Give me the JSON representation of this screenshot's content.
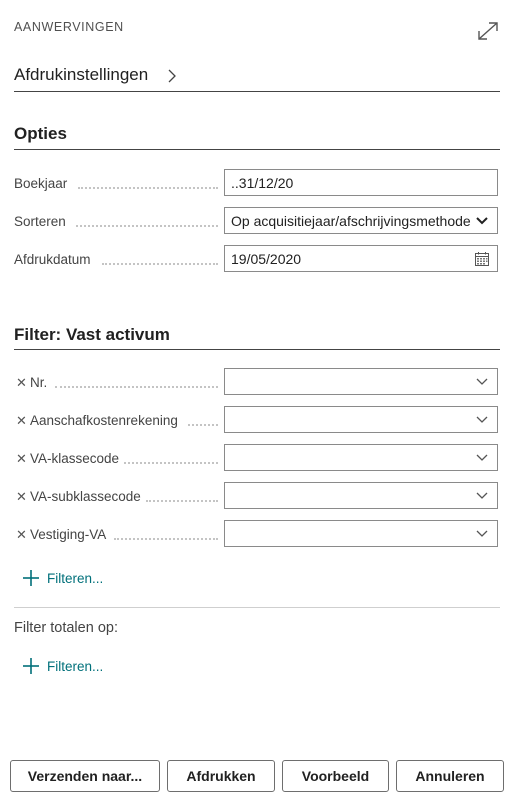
{
  "header": {
    "caption": "AANWERVINGEN",
    "expand_icon": "expand-icon"
  },
  "title": "Afdrukinstellingen",
  "options": {
    "heading": "Opties",
    "fields": [
      {
        "label": "Boekjaar",
        "value": "..31/12/20"
      },
      {
        "label": "Sorteren",
        "value": "Op acquisitiejaar/afschrijvingsmethode"
      },
      {
        "label": "Afdrukdatum",
        "value": "19/05/2020"
      }
    ]
  },
  "filter": {
    "heading": "Filter: Vast activum",
    "fields": [
      {
        "label": "Nr.",
        "value": ""
      },
      {
        "label": "Aanschafkostenrekening",
        "value": ""
      },
      {
        "label": "VA-klassecode",
        "value": ""
      },
      {
        "label": "VA-subklassecode",
        "value": ""
      },
      {
        "label": "Vestiging-VA",
        "value": ""
      }
    ],
    "add_label": "Filteren..."
  },
  "totals": {
    "label": "Filter totalen op:",
    "add_label": "Filteren..."
  },
  "buttons": {
    "send": "Verzenden naar...",
    "print": "Afdrukken",
    "preview": "Voorbeeld",
    "cancel": "Annuleren"
  },
  "colors": {
    "accent": "#00707a",
    "text": "#212121",
    "border": "#8a8a8a"
  }
}
